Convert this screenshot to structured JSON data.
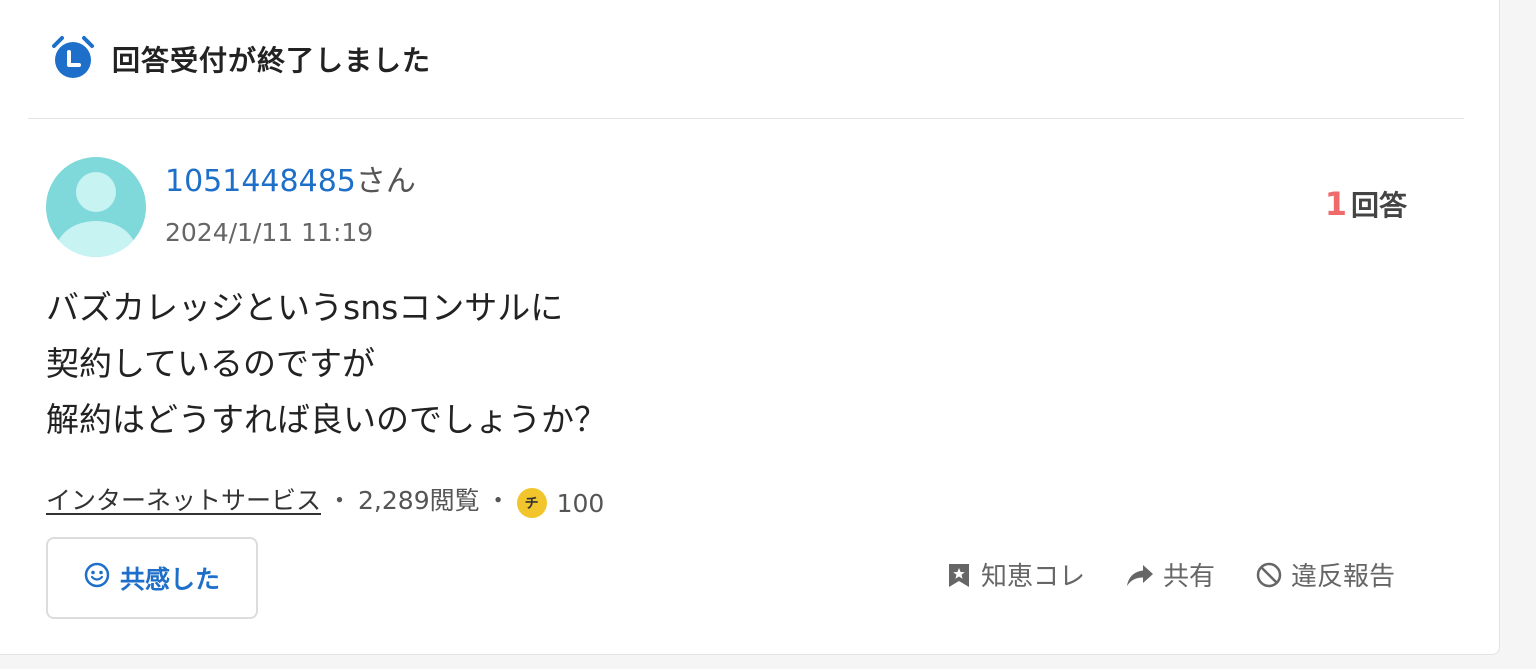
{
  "status": {
    "icon": "alarm-clock-icon",
    "title": "回答受付が終了しました"
  },
  "user": {
    "id": "1051448485",
    "suffix": "さん",
    "date": "2024/1/11 11:19",
    "avatar_icon": "default-avatar-icon"
  },
  "answers": {
    "count": "1",
    "label": "回答"
  },
  "question": {
    "lines": [
      "バズカレッジというsnsコンサルに",
      "契約しているのですが",
      "解約はどうすれば良いのでしょうか？"
    ]
  },
  "meta": {
    "category": "インターネットサービス",
    "views": "2,289閲覧",
    "separator": "・",
    "coin_icon_text": "チ",
    "coins": "100"
  },
  "buttons": {
    "empathy_label": "共感した",
    "empathy_icon": "smile-icon"
  },
  "actions": {
    "chiebukuro_label": "知恵コレ",
    "share_label": "共有",
    "report_label": "違反報告"
  },
  "colors": {
    "accent_blue": "#1e6fc9",
    "answer_count_red": "#ef6b6b",
    "coin_yellow": "#f3c52c",
    "avatar_teal": "#7fd8d9"
  }
}
